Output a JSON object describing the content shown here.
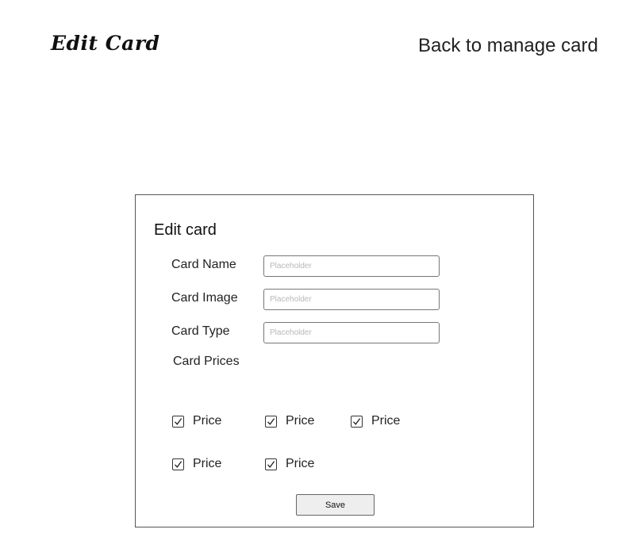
{
  "header": {
    "title": "Edit Card",
    "back_link": "Back to manage card"
  },
  "form": {
    "heading": "Edit card",
    "fields": [
      {
        "label": "Card Name",
        "placeholder": "Placeholder",
        "value": ""
      },
      {
        "label": "Card Image",
        "placeholder": "Placeholder",
        "value": ""
      },
      {
        "label": "Card Type",
        "placeholder": "Placeholder",
        "value": ""
      }
    ],
    "prices_label": "Card Prices",
    "prices": [
      {
        "label": "Price",
        "checked": true,
        "icon": "checkmark-icon"
      },
      {
        "label": "Price",
        "checked": true,
        "icon": "checkmark-icon"
      },
      {
        "label": "Price",
        "checked": true,
        "icon": "checkmark-icon"
      },
      {
        "label": "Price",
        "checked": true,
        "icon": "checkmark-icon"
      },
      {
        "label": "Price",
        "checked": true,
        "icon": "checkmark-icon"
      }
    ],
    "save_label": "Save"
  }
}
